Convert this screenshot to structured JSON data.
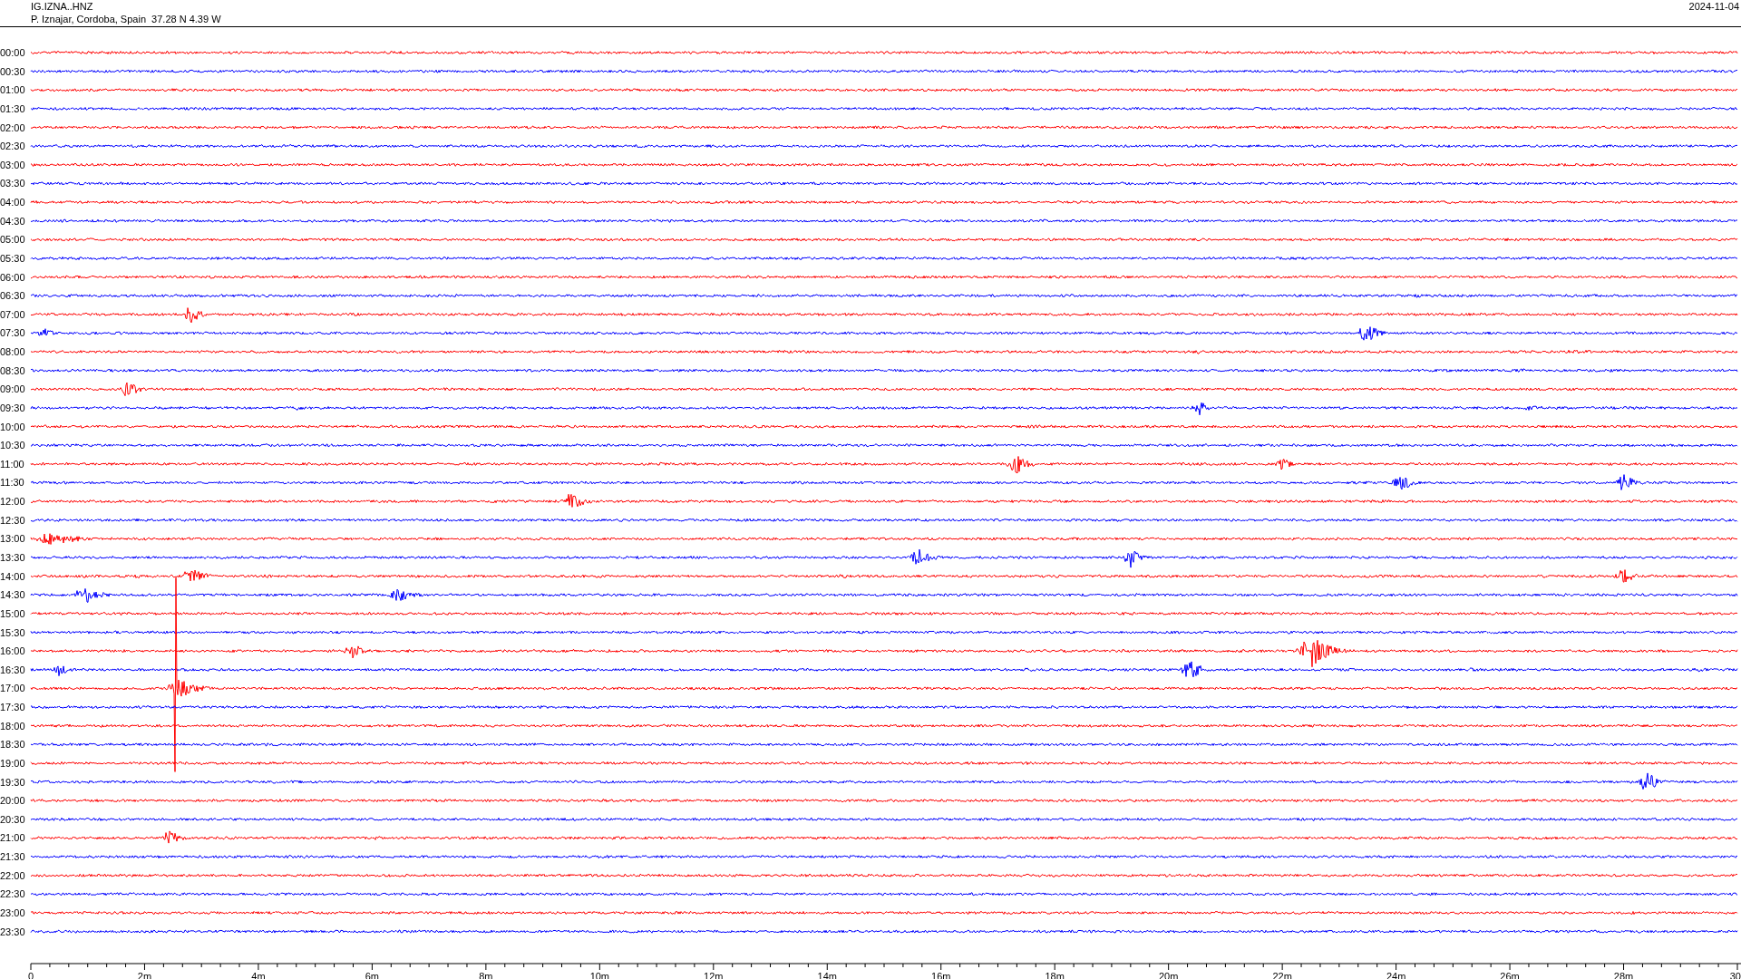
{
  "header": {
    "station": "IG.IZNA..HNZ",
    "location": "P. Iznajar, Cordoba, Spain  37.28 N 4.39 W",
    "date": "2024-11-04"
  },
  "traces": [
    {
      "time": "00:00",
      "color": "#ff0000"
    },
    {
      "time": "00:30",
      "color": "#0000ff"
    },
    {
      "time": "01:00",
      "color": "#ff0000"
    },
    {
      "time": "01:30",
      "color": "#0000ff"
    },
    {
      "time": "02:00",
      "color": "#ff0000"
    },
    {
      "time": "02:30",
      "color": "#0000ff"
    },
    {
      "time": "03:00",
      "color": "#ff0000"
    },
    {
      "time": "03:30",
      "color": "#0000ff"
    },
    {
      "time": "04:00",
      "color": "#ff0000"
    },
    {
      "time": "04:30",
      "color": "#0000ff"
    },
    {
      "time": "05:00",
      "color": "#ff0000"
    },
    {
      "time": "05:30",
      "color": "#0000ff"
    },
    {
      "time": "06:00",
      "color": "#ff0000"
    },
    {
      "time": "06:30",
      "color": "#0000ff"
    },
    {
      "time": "07:00",
      "color": "#ff0000"
    },
    {
      "time": "07:30",
      "color": "#0000ff"
    },
    {
      "time": "08:00",
      "color": "#ff0000"
    },
    {
      "time": "08:30",
      "color": "#0000ff"
    },
    {
      "time": "09:00",
      "color": "#ff0000"
    },
    {
      "time": "09:30",
      "color": "#0000ff"
    },
    {
      "time": "10:00",
      "color": "#ff0000"
    },
    {
      "time": "10:30",
      "color": "#0000ff"
    },
    {
      "time": "11:00",
      "color": "#ff0000"
    },
    {
      "time": "11:30",
      "color": "#0000ff"
    },
    {
      "time": "12:00",
      "color": "#ff0000"
    },
    {
      "time": "12:30",
      "color": "#0000ff"
    },
    {
      "time": "13:00",
      "color": "#ff0000"
    },
    {
      "time": "13:30",
      "color": "#0000ff"
    },
    {
      "time": "14:00",
      "color": "#ff0000"
    },
    {
      "time": "14:30",
      "color": "#0000ff"
    },
    {
      "time": "15:00",
      "color": "#ff0000"
    },
    {
      "time": "15:30",
      "color": "#0000ff"
    },
    {
      "time": "16:00",
      "color": "#ff0000"
    },
    {
      "time": "16:30",
      "color": "#0000ff"
    },
    {
      "time": "17:00",
      "color": "#ff0000"
    },
    {
      "time": "17:30",
      "color": "#0000ff"
    },
    {
      "time": "18:00",
      "color": "#ff0000"
    },
    {
      "time": "18:30",
      "color": "#0000ff"
    },
    {
      "time": "19:00",
      "color": "#ff0000"
    },
    {
      "time": "19:30",
      "color": "#0000ff"
    },
    {
      "time": "20:00",
      "color": "#ff0000"
    },
    {
      "time": "20:30",
      "color": "#0000ff"
    },
    {
      "time": "21:00",
      "color": "#ff0000"
    },
    {
      "time": "21:30",
      "color": "#0000ff"
    },
    {
      "time": "22:00",
      "color": "#ff0000"
    },
    {
      "time": "22:30",
      "color": "#0000ff"
    },
    {
      "time": "23:00",
      "color": "#ff0000"
    },
    {
      "time": "23:30",
      "color": "#0000ff"
    }
  ],
  "x_axis": {
    "labels": [
      "0",
      "2m",
      "4m",
      "6m",
      "8m",
      "10m",
      "12m",
      "14m",
      "16m",
      "18m",
      "20m",
      "22m",
      "24m",
      "26m",
      "28m",
      "30"
    ]
  }
}
